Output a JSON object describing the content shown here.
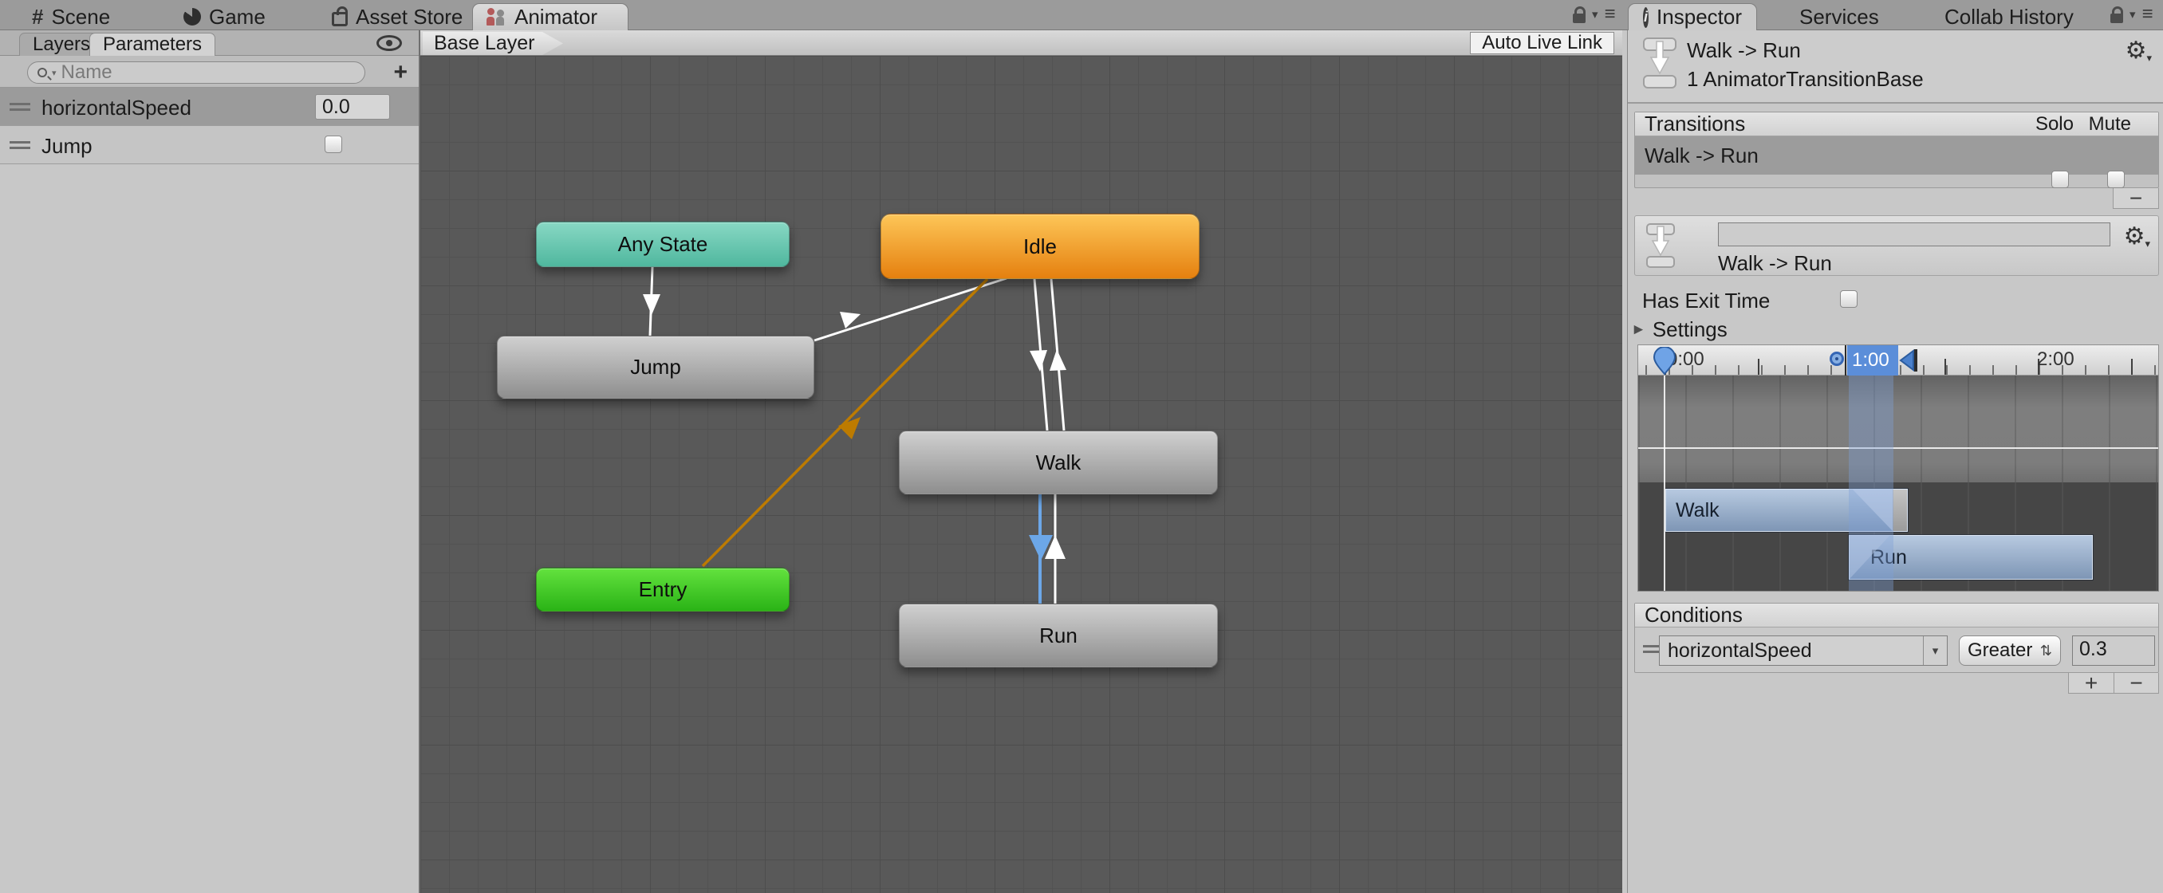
{
  "icons": {
    "gear": "⚙",
    "menu": "≡",
    "caret_down": "▾",
    "foldout": "►",
    "updown": "⇅",
    "info": "i",
    "grid": "#"
  },
  "colors": {
    "canvas_bg": "#595959",
    "panel_bg": "#c8c8c8",
    "selection_row": "#9c9c9c",
    "edge_white": "#ffffff",
    "edge_orange": "#bd7b00",
    "edge_blue": "#6ca7e8",
    "node_teal": "#4fb79e",
    "node_orange": "#e5800f",
    "node_green": "#2ab316",
    "node_gray": "#8e8e8e",
    "timeline_band_blue": "#5b8ed9",
    "bar_blue": "#7e96b5"
  },
  "window_tabs": [
    {
      "label": "Scene"
    },
    {
      "label": "Game"
    },
    {
      "label": "Asset Store"
    },
    {
      "label": "Animator",
      "active": true
    }
  ],
  "left_panel": {
    "tabs": [
      {
        "label": "Layers"
      },
      {
        "label": "Parameters",
        "active": true
      }
    ],
    "search_placeholder": "Name",
    "parameters": [
      {
        "name": "horizontalSpeed",
        "type": "float",
        "value": "0.0",
        "selected": true
      },
      {
        "name": "Jump",
        "type": "bool",
        "checked": false
      }
    ]
  },
  "canvas": {
    "breadcrumb": "Base Layer",
    "auto_live_link": "Auto Live Link",
    "nodes": [
      {
        "label": "Any State",
        "color": "teal"
      },
      {
        "label": "Idle",
        "color": "orange"
      },
      {
        "label": "Jump",
        "color": "gray"
      },
      {
        "label": "Walk",
        "color": "gray"
      },
      {
        "label": "Entry",
        "color": "green"
      },
      {
        "label": "Run",
        "color": "gray"
      }
    ],
    "edges": [
      {
        "from": "Any State",
        "to": "Jump",
        "color": "white"
      },
      {
        "from": "Jump",
        "to": "Idle",
        "color": "white"
      },
      {
        "from": "Idle",
        "to": "Walk",
        "color": "white"
      },
      {
        "from": "Walk",
        "to": "Idle",
        "color": "white"
      },
      {
        "from": "Entry",
        "to": "Idle",
        "color": "orange"
      },
      {
        "from": "Walk",
        "to": "Run",
        "color": "blue",
        "selected": true
      },
      {
        "from": "Run",
        "to": "Walk",
        "color": "white"
      }
    ]
  },
  "inspector": {
    "tabs": [
      {
        "label": "Inspector",
        "active": true
      },
      {
        "label": "Services"
      },
      {
        "label": "Collab History"
      }
    ],
    "title": "Walk -> Run",
    "subtitle": "1 AnimatorTransitionBase",
    "transitions": {
      "header": "Transitions",
      "solo": "Solo",
      "mute": "Mute",
      "rows": [
        {
          "label": "Walk -> Run",
          "solo": false,
          "mute": false
        }
      ],
      "remove_label": "−"
    },
    "detail": {
      "name_value": "",
      "label": "Walk -> Run"
    },
    "has_exit_time": {
      "label": "Has Exit Time",
      "checked": false
    },
    "settings_label": "Settings",
    "timeline": {
      "ticks": [
        "0:00",
        "1:00",
        "2:00"
      ],
      "bars": [
        {
          "label": "Walk"
        },
        {
          "label": "Run"
        }
      ]
    },
    "conditions": {
      "header": "Conditions",
      "rows": [
        {
          "param": "horizontalSpeed",
          "operator": "Greater",
          "value": "0.3"
        }
      ],
      "add_label": "+",
      "remove_label": "−"
    }
  }
}
